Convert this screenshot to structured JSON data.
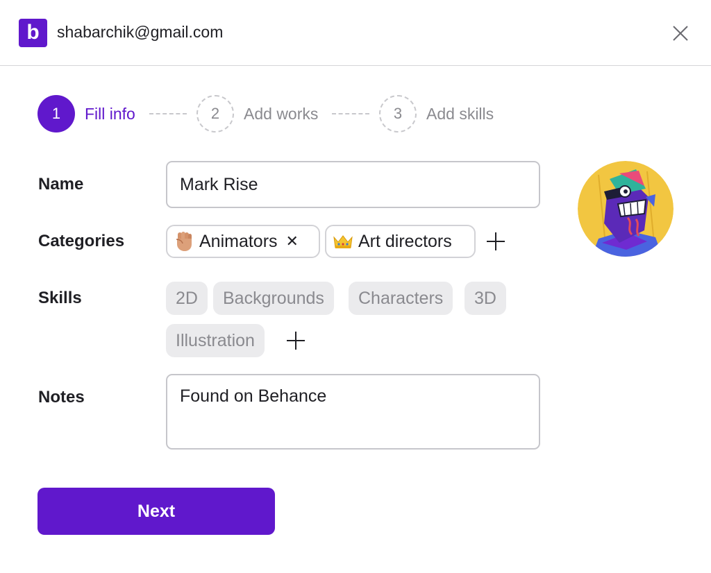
{
  "header": {
    "logo_letter": "b",
    "account_email": "shabarchik@gmail.com",
    "close_icon": "close-icon"
  },
  "stepper": {
    "steps": [
      {
        "number": "1",
        "label": "Fill info",
        "state": "active"
      },
      {
        "number": "2",
        "label": "Add works",
        "state": "pending"
      },
      {
        "number": "3",
        "label": "Add skills",
        "state": "pending"
      }
    ]
  },
  "form": {
    "name": {
      "label": "Name",
      "value": "Mark Rise"
    },
    "categories": {
      "label": "Categories",
      "items": [
        {
          "label": "Animators",
          "icon": "raised-fist-icon",
          "removable": true
        },
        {
          "label": "Art directors",
          "icon": "crown-icon",
          "removable": false
        }
      ]
    },
    "skills": {
      "label": "Skills",
      "items": [
        "2D",
        "Backgrounds",
        "Characters",
        "3D",
        "Illustration"
      ]
    },
    "notes": {
      "label": "Notes",
      "value": "Found on Behance"
    }
  },
  "actions": {
    "next_label": "Next"
  },
  "colors": {
    "accent": "#6018cc",
    "border": "#c6c6cb",
    "chip_bg": "#ebebed",
    "muted_text": "#8a8a8f"
  }
}
